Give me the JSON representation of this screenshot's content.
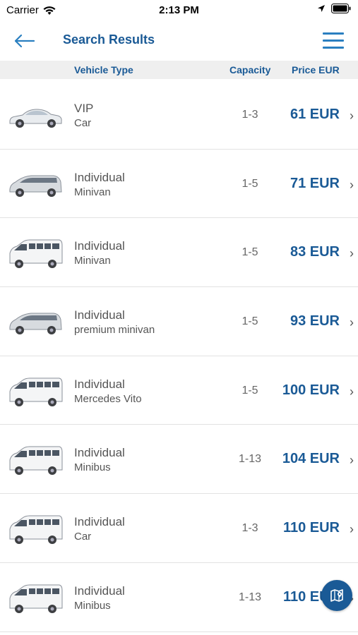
{
  "status": {
    "carrier": "Carrier",
    "time": "2:13 PM"
  },
  "nav": {
    "title": "Search Results"
  },
  "columns": {
    "type": "Vehicle Type",
    "capacity": "Capacity",
    "price": "Price EUR"
  },
  "results": [
    {
      "title": "VIP",
      "subtitle": "Car",
      "capacity": "1-3",
      "price": "61 EUR",
      "vehicle": "sedan"
    },
    {
      "title": "Individual",
      "subtitle": "Minivan",
      "capacity": "1-5",
      "price": "71 EUR",
      "vehicle": "minivan"
    },
    {
      "title": "Individual",
      "subtitle": "Minivan",
      "capacity": "1-5",
      "price": "83 EUR",
      "vehicle": "van"
    },
    {
      "title": "Individual",
      "subtitle": "premium minivan",
      "capacity": "1-5",
      "price": "93 EUR",
      "vehicle": "minivan"
    },
    {
      "title": "Individual",
      "subtitle": "Mercedes Vito",
      "capacity": "1-5",
      "price": "100 EUR",
      "vehicle": "van"
    },
    {
      "title": "Individual",
      "subtitle": "Minibus",
      "capacity": "1-13",
      "price": "104 EUR",
      "vehicle": "van"
    },
    {
      "title": "Individual",
      "subtitle": "Car",
      "capacity": "1-3",
      "price": "110 EUR",
      "vehicle": "van"
    },
    {
      "title": "Individual",
      "subtitle": "Minibus",
      "capacity": "1-13",
      "price": "110 EUR",
      "vehicle": "van"
    }
  ],
  "icons": {
    "back": "arrow-left-icon",
    "menu": "hamburger-icon",
    "fab": "map-icon",
    "row": "chevron-right-icon"
  },
  "colors": {
    "accent": "#1a5a96",
    "header_bg": "#efefef"
  }
}
